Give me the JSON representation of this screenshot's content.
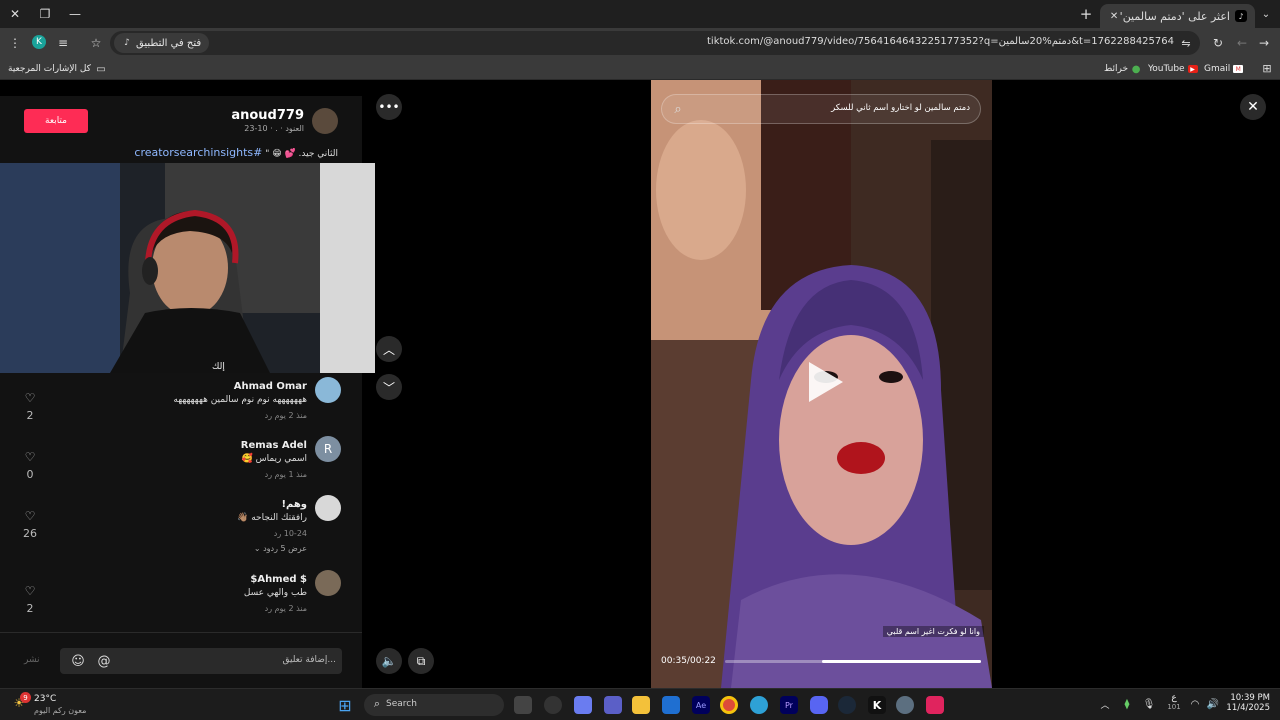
{
  "browser": {
    "tab_title": "اعثر على 'دمتم سالمين' على Tok",
    "url": "tiktok.com/@anoud779/video/7564164643225177352?q=دمتم%20سالمين&t=1762288425764",
    "open_in_app": "فتح في التطبيق",
    "profile_letter": "K",
    "bookmarks": {
      "all_bookmarks": "كل الإشارات المرجعية",
      "gmail": "Gmail",
      "youtube": "YouTube",
      "maps": "خرائط"
    }
  },
  "post": {
    "username": "anoud779",
    "subtitle": "العنود · . · 10-23",
    "follow_label": "متابعة",
    "caption_hashtag": "#creatorsearchinsights",
    "caption_text": "الثاني جيد. 💕 😁 \""
  },
  "comments": [
    {
      "name": "Ahmad Omar",
      "text": "هههههههه نوم نوم سالمين هههههههه",
      "meta": "منذ 2 يوم     رد",
      "likes": "2",
      "avatar_color": "#8ab8d8",
      "avatar_letter": ""
    },
    {
      "name": "Remas Adel",
      "text": "اسمي ريماس 🥰",
      "meta": "منذ 1 يوم     رد",
      "likes": "0",
      "avatar_color": "#7d8fa1",
      "avatar_letter": "R"
    },
    {
      "name": "وهم!",
      "text": "رافقتك النجاحه 👋🏽",
      "meta": "10-24     رد",
      "likes": "26",
      "avatar_color": "#d8d8d8",
      "avatar_letter": ""
    },
    {
      "name": "$ Ahmed$",
      "text": "طب والهي عسل",
      "meta": "منذ 2 يوم     رد",
      "likes": "2",
      "avatar_color": "#7a6a58",
      "avatar_letter": ""
    }
  ],
  "view_replies": "عرض 5 ردود",
  "comment_input": {
    "placeholder": "إضافة تعليق...",
    "post_label": "نشر"
  },
  "video": {
    "search_text": "دمتم سالمين لو اختارو اسم ثاني للسكر",
    "overlay_caption": "وانا لو فكرت اغير اسم قلبي",
    "time": "00:35/00:22",
    "progress": 0.62
  },
  "webcam_shirt_text": "إلك",
  "taskbar": {
    "weather_temp": "23°C",
    "weather_desc": "معون ركم اليوم",
    "weather_badge": "9",
    "search_label": "Search",
    "time": "10:39 PM",
    "date": "11/4/2025",
    "lang": "ع",
    "lang_sub": "101"
  }
}
